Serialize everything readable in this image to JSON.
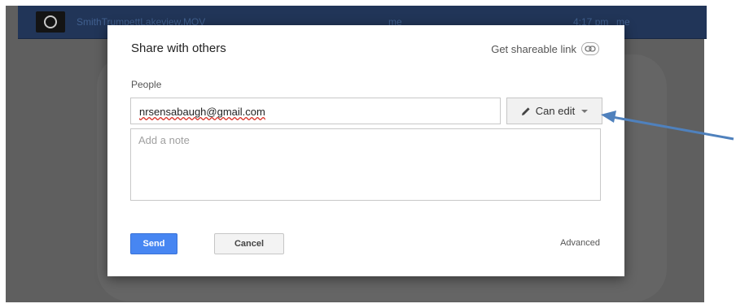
{
  "background_app": {
    "file_name": "SmithTrumpettLakeview.MOV",
    "owner": "me",
    "modified": "4:17 pm",
    "modified_by": "me"
  },
  "dialog": {
    "title": "Share with others",
    "get_link_label": "Get shareable link",
    "people_label": "People",
    "email_value": "nrsensabaugh@gmail.com",
    "permission_label": "Can edit",
    "note_placeholder": "Add a note",
    "send_label": "Send",
    "cancel_label": "Cancel",
    "advanced_label": "Advanced"
  },
  "colors": {
    "send_button": "#4786f2",
    "annotation_arrow": "#4f81bd",
    "header_row": "#213558"
  },
  "icons": {
    "link": "link-icon",
    "pencil": "pencil-icon",
    "dropdown": "chevron-down-icon",
    "video_thumbnail": "video-thumbnail-icon"
  }
}
